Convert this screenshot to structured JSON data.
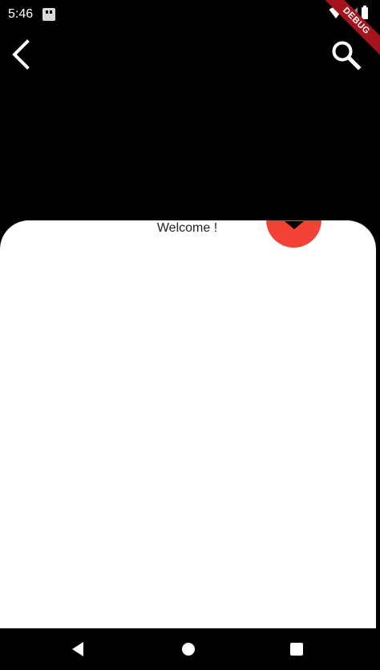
{
  "status_bar": {
    "time": "5:46",
    "icons": [
      "app-notification-icon",
      "wifi-icon",
      "signal-icon",
      "battery-icon"
    ]
  },
  "debug_banner": {
    "label": "DEBUG",
    "color": "#a3141c"
  },
  "app_bar": {
    "back_icon": "back-arrow-icon",
    "search_icon": "search-icon"
  },
  "content": {
    "welcome_text": "Welcome !"
  },
  "fab": {
    "icon": "chevron-down-icon",
    "color": "#f44336"
  },
  "nav_bar": {
    "icons": [
      "nav-back-icon",
      "nav-home-icon",
      "nav-recents-icon"
    ]
  }
}
